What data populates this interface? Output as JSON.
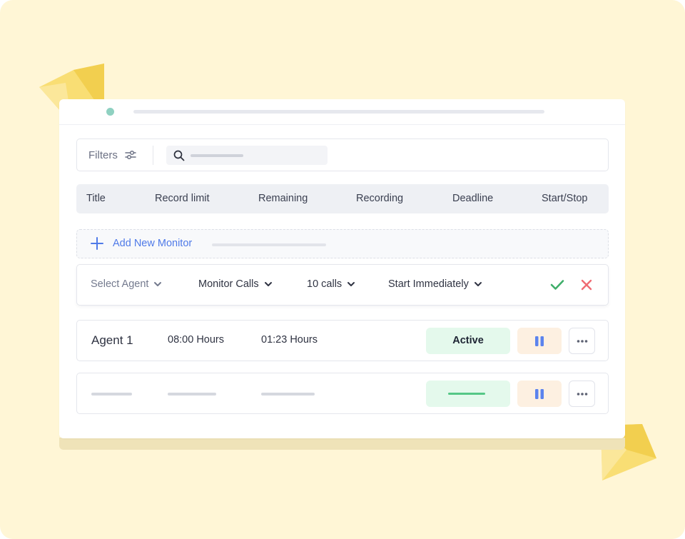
{
  "toolbar": {
    "filters_label": "Filters",
    "search_icon": "search-icon",
    "filter_icon": "sliders-icon"
  },
  "table": {
    "columns": [
      "Title",
      "Record limit",
      "Remaining",
      "Recording",
      "Deadline",
      "Start/Stop"
    ]
  },
  "add_monitor": {
    "label": "Add New Monitor",
    "icon": "plus-icon"
  },
  "editor": {
    "agent_select": "Select Agent",
    "monitor_type": "Monitor Calls",
    "limit": "10 calls",
    "start": "Start Immediately",
    "confirm_icon": "check-icon",
    "cancel_icon": "close-icon"
  },
  "rows": [
    {
      "title": "Agent 1",
      "record_limit": "08:00 Hours",
      "remaining": "01:23 Hours",
      "status": "Active"
    }
  ],
  "colors": {
    "background": "#fff6d6",
    "accent_blue": "#4f7ae8",
    "active_green": "#e4f9ec",
    "pause_bg": "#fdf0e1",
    "confirm_green": "#3fae6a",
    "cancel_red": "#ef6b73"
  }
}
